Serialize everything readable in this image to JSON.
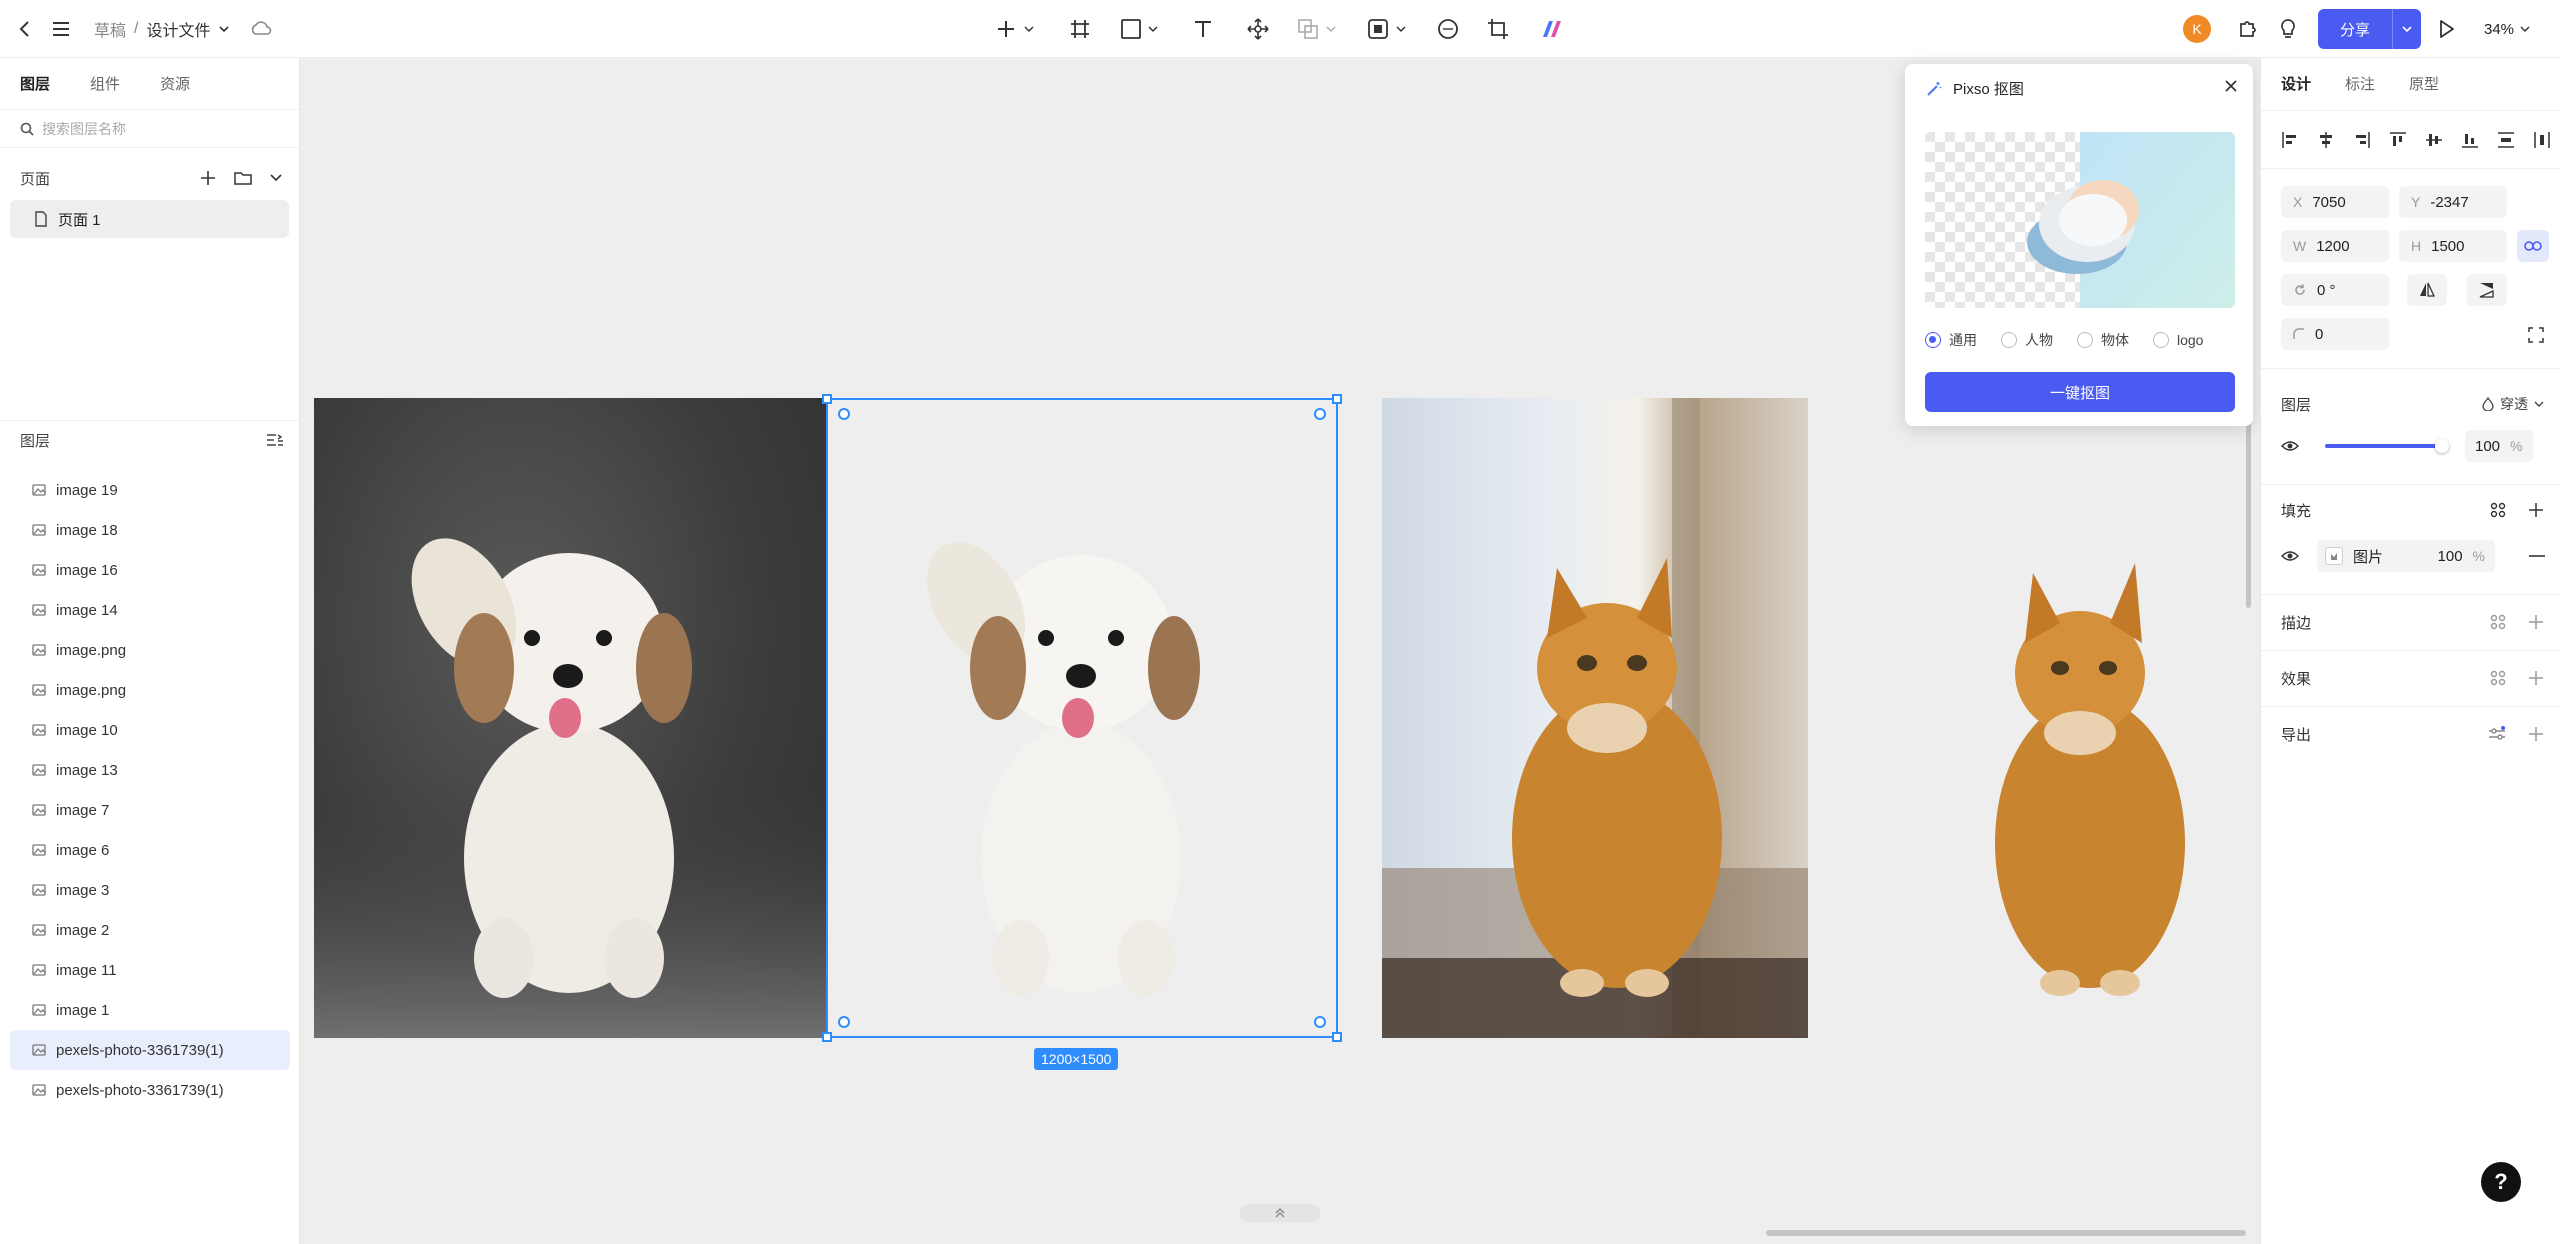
{
  "topbar": {
    "breadcrumb_root": "草稿",
    "breadcrumb_sep": "/",
    "file_name": "设计文件",
    "avatar_initial": "K",
    "share_label": "分享",
    "zoom": "34%",
    "accent": "#4a5bf2"
  },
  "left": {
    "tabs": [
      "图层",
      "组件",
      "资源"
    ],
    "search_placeholder": "搜索图层名称",
    "pages_header": "页面",
    "pages": [
      "页面 1"
    ],
    "layers_header": "图层",
    "layers": [
      "image 19",
      "image 18",
      "image 16",
      "image 14",
      "image.png",
      "image.png",
      "image 10",
      "image 13",
      "image 7",
      "image 6",
      "image 3",
      "image 2",
      "image 11",
      "image 1",
      "pexels-photo-3361739(1)",
      "pexels-photo-3361739(1)"
    ],
    "selected_layer": "pexels-photo-3361739(1)"
  },
  "canvas": {
    "selection_size": "1200×1500"
  },
  "popup": {
    "title": "Pixso 抠图",
    "options": [
      "通用",
      "人物",
      "物体",
      "logo"
    ],
    "selected_option": "通用",
    "button": "一键抠图"
  },
  "right": {
    "tabs": [
      "设计",
      "标注",
      "原型"
    ],
    "x_label": "X",
    "x": "7050",
    "y_label": "Y",
    "y": "-2347",
    "w_label": "W",
    "w": "1200",
    "h_label": "H",
    "h": "1500",
    "rotation": "0 °",
    "radius": "0",
    "layer_section": "图层",
    "blend_mode": "穿透",
    "opacity": "100",
    "opacity_unit": "%",
    "opacity_level": 1.0,
    "fill_section": "填充",
    "fill_type": "图片",
    "fill_opacity": "100",
    "fill_unit": "%",
    "stroke_section": "描边",
    "effect_section": "效果",
    "export_section": "导出"
  }
}
